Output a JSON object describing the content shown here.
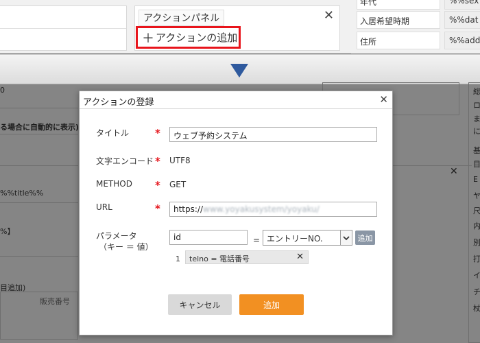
{
  "callout": {
    "panel_title": "アクションパネル",
    "close_glyph": "✕",
    "add_action_label": "アクションの追加",
    "add_action_plus": "＋",
    "highlight_color": "#e8141b"
  },
  "right_table": {
    "rows": [
      {
        "label": "年代",
        "value": "%%sex"
      },
      {
        "label": "入居希望時期",
        "value": "%%dat"
      },
      {
        "label": "住所",
        "value": "%%add"
      }
    ]
  },
  "background": {
    "auto_display": "る場合に自動的に表示)",
    "title_field": "%%title%%",
    "percent_bracket": "%】",
    "add_tab": "目追加)",
    "sale_number": "販売番号",
    "zero": "0",
    "close_glyph": "✕",
    "right_col_chars": [
      "総",
      "ロ",
      "ま",
      "に",
      "基",
      "目",
      "E",
      "ヤ",
      "尺",
      "内",
      "別",
      "打",
      "イ",
      "チ",
      "杖"
    ]
  },
  "modal": {
    "title": "アクションの登録",
    "close_glyph": "✕",
    "required_mark": "*",
    "fields": {
      "title_label": "タイトル",
      "title_value": "ウェブ予約システム",
      "encoding_label": "文字エンコード",
      "encoding_value": "UTF8",
      "method_label": "METHOD",
      "method_value": "GET",
      "url_label": "URL",
      "url_prefix": "https://",
      "url_blurred": "www.yoyakusystem/yoyaku/",
      "param_label_1": "パラメータ",
      "param_label_2": "（キー ＝ 値）",
      "param_key": "id",
      "param_eq": "=",
      "param_select": "エントリーNO.",
      "param_add": "追加",
      "param_index": "1",
      "param_item": "telno = 電話番号",
      "param_item_close": "✕"
    },
    "buttons": {
      "cancel": "キャンセル",
      "submit": "追加"
    },
    "colors": {
      "required": "#e5141b",
      "submit_bg": "#f29022",
      "add_small_bg": "#8a96a5",
      "arrow": "#2f5a9e"
    }
  }
}
